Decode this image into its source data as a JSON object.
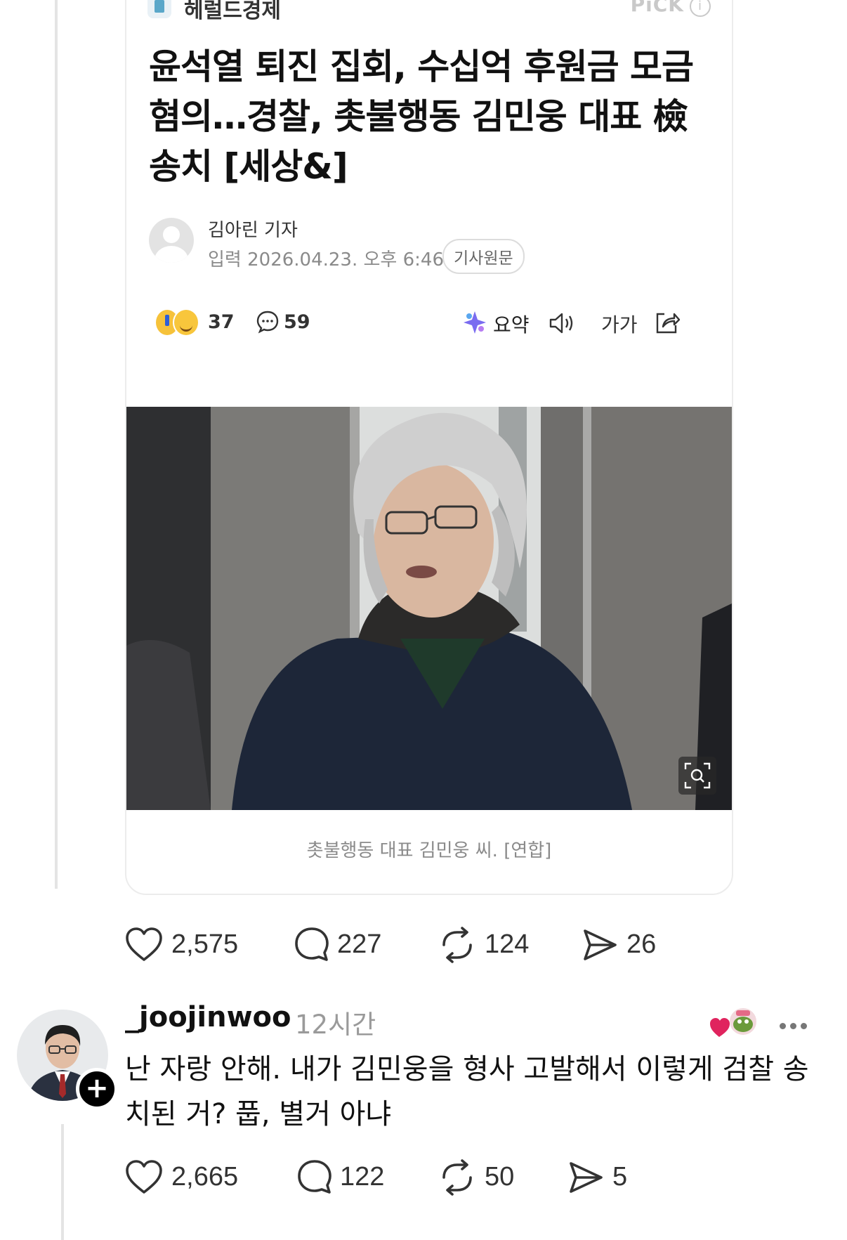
{
  "article": {
    "press_name": "헤럴드경제",
    "pick_label": "PiCK",
    "pick_info": "i",
    "headline": "윤석열 퇴진 집회, 수십억 후원금 모금 혐의…경찰, 촛불행동 김민웅 대표 檢 송치 [세상&]",
    "reporter": "김아린 기자",
    "published": "입력 2026.04.23. 오후 6:46",
    "original_button": "기사원문",
    "reaction_count": "37",
    "comment_count": "59",
    "summary_label": "요약",
    "font_size_label": "가가",
    "photo_caption": "촛불행동 대표 김민웅 씨. [연합]"
  },
  "post_stats": {
    "likes": "2,575",
    "replies": "227",
    "reposts": "124",
    "shares": "26"
  },
  "reply": {
    "handle": "_joojinwoo",
    "time": "12시간",
    "text": "난 자랑 안해. 내가 김민웅을 형사 고발해서 이렇게 검찰 송치된 거? 풉, 별거 아냐",
    "follow_symbol": "+",
    "likes": "2,665",
    "replies": "122",
    "reposts": "50",
    "shares": "5"
  },
  "colors": {
    "text_primary": "#111111",
    "text_muted": "#8a8a8a",
    "card_border": "#ececec",
    "like_heart": "#e0245e"
  }
}
